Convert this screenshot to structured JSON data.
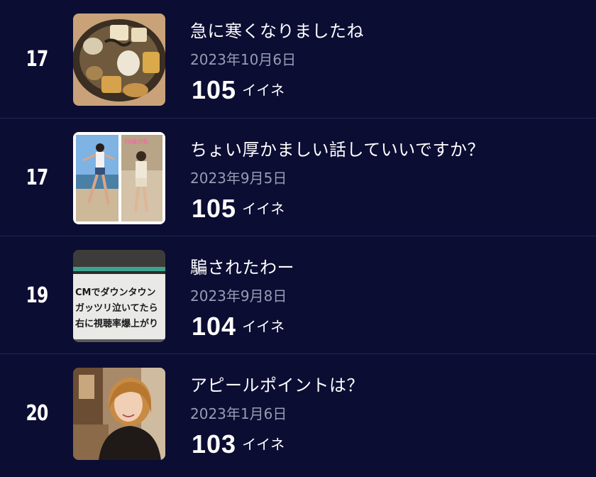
{
  "posts": [
    {
      "rank": "17",
      "title": "急に寒くなりましたね",
      "date": "2023年10月6日",
      "likes": "105",
      "likes_label": "イイネ",
      "thumbnail": "stew-bowl-photo"
    },
    {
      "rank": "17",
      "title": "ちょい厚かましい話していいですか？",
      "date": "2023年9月5日",
      "likes": "105",
      "likes_label": "イイネ",
      "thumbnail": "beach-photo-collage",
      "thumbnail_text": "20歳の私"
    },
    {
      "rank": "19",
      "title": "騙されたわー",
      "date": "2023年9月8日",
      "likes": "104",
      "likes_label": "イイネ",
      "thumbnail": "tv-screen-caption-photo",
      "thumbnail_text": [
        "CMでダウンタウン",
        "ガッツリ泣いてたら",
        "右に視聴率爆上がり"
      ]
    },
    {
      "rank": "20",
      "title": "アピールポイントは？",
      "date": "2023年1月6日",
      "likes": "103",
      "likes_label": "イイネ",
      "thumbnail": "portrait-photo"
    }
  ]
}
